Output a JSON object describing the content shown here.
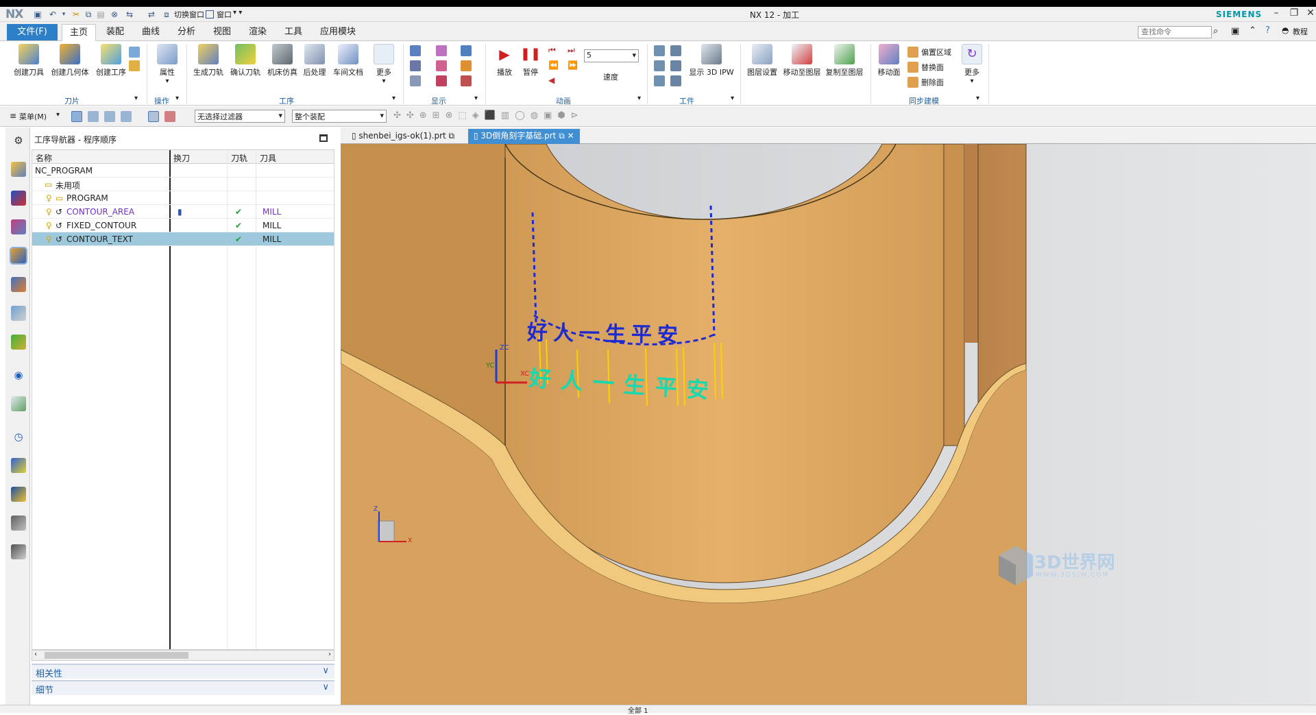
{
  "app": {
    "logo": "NX",
    "title": "NX 12 - 加工",
    "brand": "SIEMENS",
    "tutorial": "教程"
  },
  "quick_access": {
    "switch_window": "切换窗口",
    "window": "窗口"
  },
  "menu": {
    "file": "文件(F)",
    "tabs": [
      "主页",
      "装配",
      "曲线",
      "分析",
      "视图",
      "渲染",
      "工具",
      "应用模块"
    ],
    "search_placeholder": "查找命令"
  },
  "ribbon": {
    "blade": {
      "create_tool": "创建刀具",
      "create_geometry": "创建几何体",
      "create_operation": "创建工序",
      "group": "刀片"
    },
    "operation": {
      "properties": "属性",
      "group": "操作"
    },
    "process": {
      "generate": "生成刀轨",
      "verify": "确认刀轨",
      "simulate": "机床仿真",
      "postprocess": "后处理",
      "shop_doc": "车间文档",
      "more": "更多",
      "group": "工序"
    },
    "display": {
      "group": "显示"
    },
    "animation": {
      "play": "播放",
      "pause": "暂停",
      "speed_value": "5",
      "speed": "速度",
      "group": "动画"
    },
    "workpiece": {
      "show_ipw": "显示 3D IPW",
      "group": "工件"
    },
    "layers": {
      "layer_settings": "图层设置",
      "move_to_layer": "移动至图层",
      "copy_to_layer": "复制至图层"
    },
    "sync": {
      "move_face": "移动面",
      "offset_region": "偏置区域",
      "replace_face": "替换面",
      "delete_face": "删除面",
      "more": "更多",
      "group": "同步建模"
    }
  },
  "filterbar": {
    "menu": "菜单(M)",
    "filter": "无选择过滤器",
    "scope": "整个装配"
  },
  "navigator": {
    "title": "工序导航器 - 程序顺序",
    "columns": [
      "名称",
      "换刀",
      "刀轨",
      "刀具"
    ],
    "rows": [
      {
        "name": "NC_PROGRAM",
        "tool": ""
      },
      {
        "name": "未用项",
        "tool": ""
      },
      {
        "name": "PROGRAM",
        "tool": ""
      },
      {
        "name": "CONTOUR_AREA",
        "tool": "MILL"
      },
      {
        "name": "FIXED_CONTOUR",
        "tool": "MILL"
      },
      {
        "name": "CONTOUR_TEXT",
        "tool": "MILL"
      }
    ],
    "panels": [
      "相关性",
      "细节"
    ]
  },
  "viewport_tabs": [
    "shenbei_igs-ok(1).prt",
    "3D倒角刻字基础.prt"
  ],
  "viewport": {
    "engraved_text": "好人一生平安",
    "projected_text": "好人一生平安",
    "axis_labels": {
      "zc": "ZC",
      "xc": "XC",
      "yc": "YC",
      "z": "Z",
      "x": "X"
    },
    "watermark": "3D世界网",
    "watermark_url": "WWW.3DSJW.COM"
  },
  "status": {
    "text": "全部 1"
  },
  "colors": {
    "accent": "#2d7fc7",
    "model": "#d9a45c",
    "toolpath": "#1e2ad0",
    "engrave": "#18d8b0",
    "lines": "#ffd000",
    "selection": "#9ec9dd"
  }
}
